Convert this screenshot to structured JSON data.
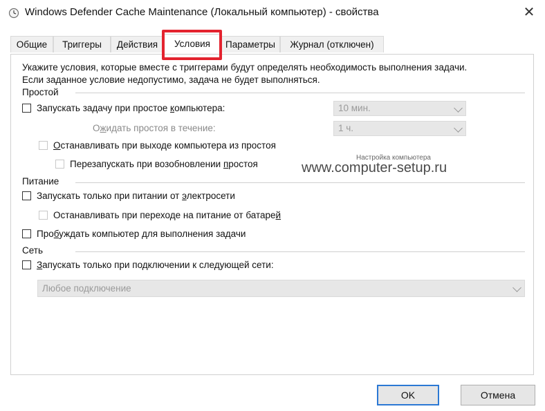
{
  "window": {
    "title": "Windows Defender Cache Maintenance (Локальный компьютер) - свойства",
    "close_glyph": "✕"
  },
  "tabs": [
    {
      "label": "Общие",
      "active": false
    },
    {
      "label": "Триггеры",
      "active": false
    },
    {
      "label": "Действия",
      "active": false
    },
    {
      "label": "Условия",
      "active": true
    },
    {
      "label": "Параметры",
      "active": false
    },
    {
      "label": "Журнал (отключен)",
      "active": false
    }
  ],
  "conditions": {
    "intro_line1": "Укажите условия, которые вместе с триггерами будут определять необходимость выполнения задачи.",
    "intro_line2": "Если заданное условие недопустимо, задача не будет выполняться.",
    "idle": {
      "group_label": "Простой",
      "start_on_idle": {
        "pre": "Запускать задачу при простое ",
        "u": "к",
        "post": "омпьютера:",
        "checked": false
      },
      "idle_duration": {
        "value": "10 мин."
      },
      "wait_label": {
        "pre": "О",
        "u": "ж",
        "post": "идать простоя в течение:"
      },
      "wait_duration": {
        "value": "1 ч."
      },
      "stop_on_idle_end": {
        "pre": "",
        "u": "О",
        "post": "станавливать при выходе компьютера из простоя",
        "checked": false
      },
      "restart_on_idle": {
        "pre": "Перезапускать при возобновлении ",
        "u": "п",
        "post": "ростоя",
        "checked": false
      }
    },
    "power": {
      "group_label": "Питание",
      "ac_only": {
        "pre": "Запускать только при питании от ",
        "u": "э",
        "post": "лектросети",
        "checked": false
      },
      "stop_on_battery": {
        "pre": "Останавливать при переходе на питание от батаре",
        "u": "й",
        "post": "",
        "checked": false
      },
      "wake": {
        "pre": "Про",
        "u": "б",
        "post": "уждать компьютер для выполнения задачи",
        "checked": false
      }
    },
    "network": {
      "group_label": "Сеть",
      "network_only": {
        "pre": "",
        "u": "З",
        "post": "апускать только при подключении к следующей сети:",
        "checked": false
      },
      "network_select": {
        "value": "Любое подключение"
      }
    }
  },
  "watermark": {
    "small": "Настройка компьютера",
    "big": "www.computer-setup.ru"
  },
  "buttons": {
    "ok": "OK",
    "cancel": "Отмена"
  },
  "colors": {
    "highlight": "#e3232f",
    "default_button_border": "#2b78d4"
  }
}
